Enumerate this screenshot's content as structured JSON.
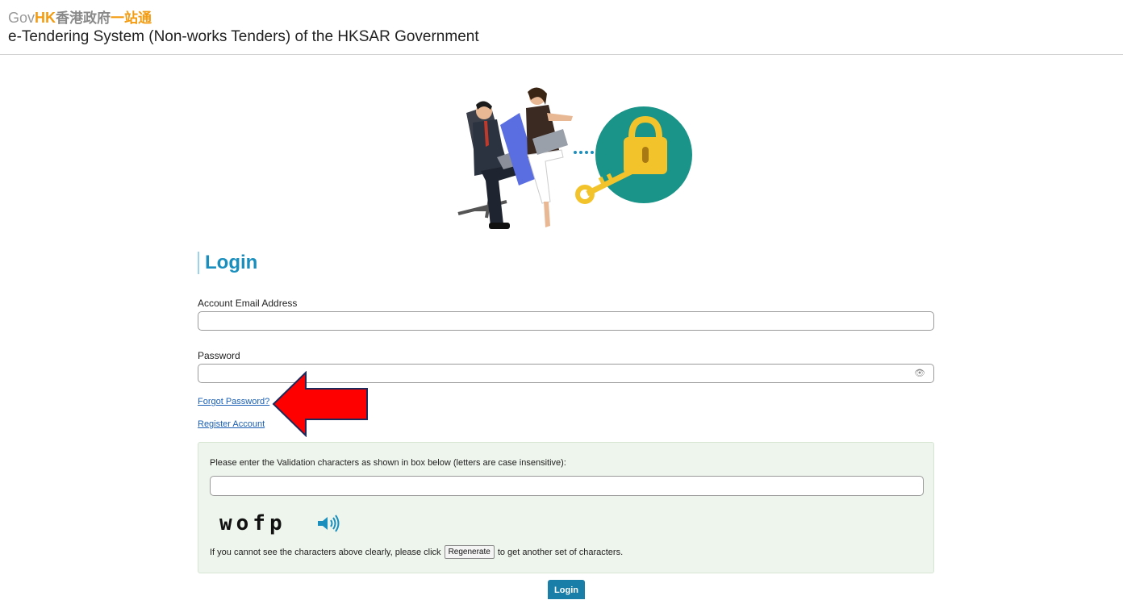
{
  "header": {
    "logo_gov": "Gov",
    "logo_hk": "HK",
    "logo_zh": "香港政府",
    "logo_zh2": "一站通",
    "system_title": "e-Tendering System (Non-works Tenders) of the HKSAR Government"
  },
  "login": {
    "title": "Login",
    "email_label": "Account Email Address",
    "email_value": "",
    "password_label": "Password",
    "password_value": "",
    "forgot_link": "Forgot Password?",
    "register_link": "Register Account",
    "submit_label": "Login"
  },
  "validation": {
    "instructions": "Please enter the Validation characters as shown in box below (letters are case insensitive):",
    "input_value": "",
    "captcha_text": "wofp",
    "regen_prefix": "If you cannot see the characters above clearly, please click",
    "regen_button": "Regenerate",
    "regen_suffix": "to get another set of characters."
  },
  "icons": {
    "eye": "eye-icon",
    "speaker": "speaker-icon",
    "arrow": "red-arrow-annotation"
  },
  "colors": {
    "accent_blue": "#1a8fbd",
    "logo_orange": "#f39c12",
    "validation_bg": "#eef5ec",
    "button_blue": "#1a7fa8",
    "arrow_red": "#ff0000"
  }
}
